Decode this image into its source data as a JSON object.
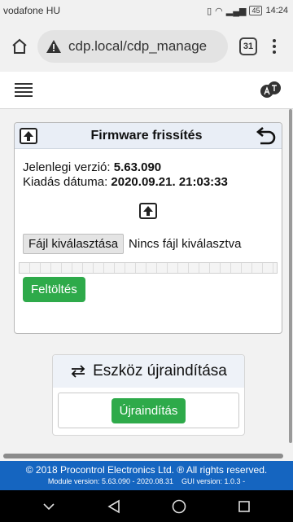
{
  "status_bar": {
    "carrier": "vodafone HU",
    "battery": "45",
    "time": "14:24"
  },
  "browser": {
    "url": "cdp.local/cdp_manage",
    "tab_count": "31"
  },
  "firmware_card": {
    "title": "Firmware frissítés",
    "version_label": "Jelenlegi verzió:",
    "version_value": "5.63.090",
    "date_label": "Kiadás dátuma:",
    "date_value": "2020.09.21. 21:03:33",
    "choose_file_label": "Fájl kiválasztása",
    "no_file_label": "Nincs fájl kiválasztva",
    "progress": 0,
    "upload_label": "Feltöltés"
  },
  "restart_card": {
    "title": "Eszköz újraindítása",
    "restart_label": "Újraindítás"
  },
  "footer": {
    "copyright": "© 2018 Procontrol Electronics Ltd. ® All rights reserved.",
    "module_version": "Module version: 5.63.090 - 2020.08.31",
    "gui_version": "GUI version: 1.0.3 -"
  },
  "colors": {
    "accent_green": "#2eaa4a",
    "footer_blue": "#1565c0",
    "card_header": "#e9eef6"
  }
}
